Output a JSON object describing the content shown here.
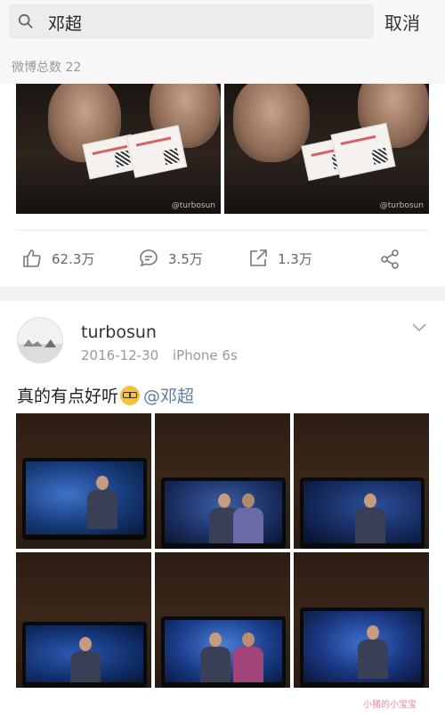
{
  "search": {
    "query": "邓超",
    "cancel_label": "取消"
  },
  "result_count": "微博总数 22",
  "post1": {
    "photo_watermark_a": "@turbosun",
    "photo_watermark_b": "@turbosun",
    "actions": {
      "likes": "62.3万",
      "comments": "3.5万",
      "reposts": "1.3万"
    }
  },
  "post2": {
    "username": "turbosun",
    "date": "2016-12-30",
    "device": "iPhone 6s",
    "text": "真的有点好听",
    "mention": "@邓超"
  },
  "corner_watermark": "小猪的小宝宝",
  "colors": {
    "link": "#5b7da8",
    "meta": "#999999",
    "bar_bg": "#f7f7f7"
  }
}
